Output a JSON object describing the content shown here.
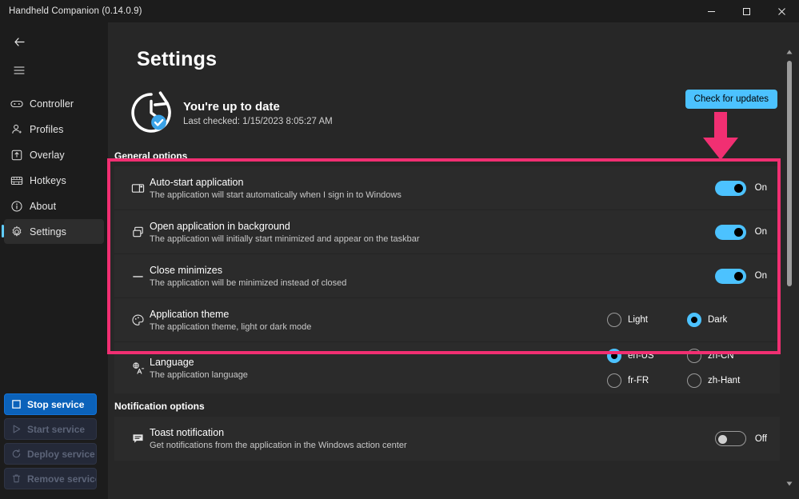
{
  "window": {
    "title": "Handheld Companion (0.14.0.9)",
    "controls": {
      "minimize": "minimize-icon",
      "maximize": "maximize-icon",
      "close": "close-icon"
    }
  },
  "sidebar": {
    "back_label": "back-arrow-icon",
    "menu_label": "hamburger-menu-icon",
    "items": [
      {
        "label": "Controller",
        "icon": "controller-icon",
        "selected": false
      },
      {
        "label": "Profiles",
        "icon": "profiles-icon",
        "selected": false
      },
      {
        "label": "Overlay",
        "icon": "overlay-icon",
        "selected": false
      },
      {
        "label": "Hotkeys",
        "icon": "hotkeys-icon",
        "selected": false
      },
      {
        "label": "About",
        "icon": "about-icon",
        "selected": false
      },
      {
        "label": "Settings",
        "icon": "gear-icon",
        "selected": true
      }
    ],
    "services": [
      {
        "label": "Stop service",
        "icon": "stop-square-icon",
        "state": "active"
      },
      {
        "label": "Start service",
        "icon": "play-triangle-icon",
        "state": "disabled"
      },
      {
        "label": "Deploy service",
        "icon": "refresh-icon",
        "state": "disabled"
      },
      {
        "label": "Remove service",
        "icon": "trash-icon",
        "state": "disabled"
      }
    ]
  },
  "page": {
    "title": "Settings",
    "update": {
      "icon": "update-clock-check-icon",
      "status": "You're up to date",
      "last_checked": "Last checked: 1/15/2023 8:05:27 AM",
      "button_label": "Check for updates"
    },
    "sections": [
      {
        "header": "General options",
        "rows": [
          {
            "icon": "auto-start-window-icon",
            "title": "Auto-start application",
            "desc": "The application will start automatically when I sign in to Windows",
            "control": "toggle",
            "toggle_state": "on",
            "toggle_label": "On"
          },
          {
            "icon": "background-windows-icon",
            "title": "Open application in background",
            "desc": "The application will initially start minimized and appear on the taskbar",
            "control": "toggle",
            "toggle_state": "on",
            "toggle_label": "On"
          },
          {
            "icon": "minimize-dash-icon",
            "title": "Close minimizes",
            "desc": "The application will be minimized instead of closed",
            "control": "toggle",
            "toggle_state": "on",
            "toggle_label": "On"
          },
          {
            "icon": "palette-icon",
            "title": "Application theme",
            "desc": "The application theme, light or dark mode",
            "control": "radio",
            "options": [
              {
                "label": "Light",
                "checked": false
              },
              {
                "label": "Dark",
                "checked": true
              }
            ]
          },
          {
            "icon": "language-translate-icon",
            "title": "Language",
            "desc": "The application language",
            "control": "radio-grid",
            "options": [
              {
                "label": "en-US",
                "checked": true
              },
              {
                "label": "zh-CN",
                "checked": false
              },
              {
                "label": "fr-FR",
                "checked": false
              },
              {
                "label": "zh-Hant",
                "checked": false
              }
            ]
          }
        ]
      },
      {
        "header": "Notification options",
        "rows": [
          {
            "icon": "toast-notification-icon",
            "title": "Toast notification",
            "desc": "Get notifications from the application in the Windows action center",
            "control": "toggle",
            "toggle_state": "off",
            "toggle_label": "Off"
          }
        ]
      }
    ]
  },
  "annotation": {
    "highlight_color": "#f12f72",
    "arrow": "down-arrow-annotation",
    "box": "highlight-rectangle-annotation"
  },
  "scrollbar": {
    "up": "scroll-up-arrow-icon",
    "down": "scroll-down-arrow-icon",
    "thumb": "scroll-thumb"
  },
  "colors": {
    "accent": "#4cc2ff",
    "annotation": "#f12f72",
    "service_active": "#0b62ba",
    "background": "#272727"
  }
}
